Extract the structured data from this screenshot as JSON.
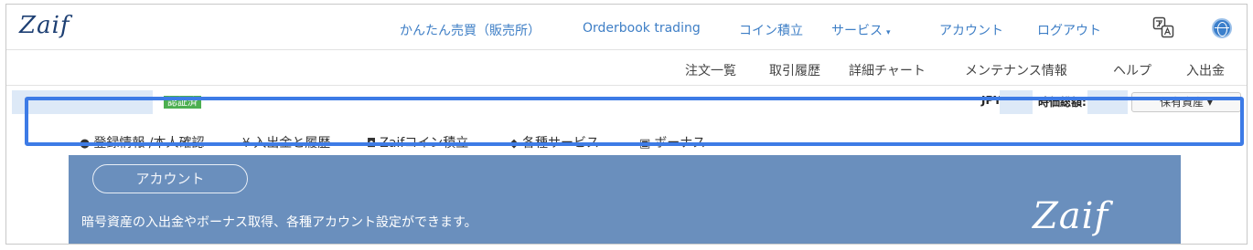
{
  "brand": {
    "logo_text": "Zaif"
  },
  "topnav": {
    "items": [
      {
        "label": "かんたん売買（販売所）"
      },
      {
        "label": "Orderbook trading"
      },
      {
        "label": "コイン積立"
      },
      {
        "label": "サービス",
        "dropdown": true
      },
      {
        "label": "アカウント"
      },
      {
        "label": "ログアウト"
      }
    ],
    "service_chevron": "▾",
    "icons": [
      "translate-icon",
      "globe-icon"
    ]
  },
  "subnav": {
    "items": [
      {
        "label": "注文一覧"
      },
      {
        "label": "取引履歴"
      },
      {
        "label": "詳細チャート"
      },
      {
        "label": "メンテナンス情報"
      },
      {
        "label": "ヘルプ"
      },
      {
        "label": "入出金"
      }
    ]
  },
  "account": {
    "verified_badge": "認証済",
    "jpy_label": "JPY:",
    "total_label": "時価総額:",
    "holdings_button": "保有資産 ▾"
  },
  "account_tabs": [
    {
      "label": "登録情報 /本人確認",
      "icon": "person-icon"
    },
    {
      "label": "入出金と履歴",
      "icon": "yen-icon"
    },
    {
      "label": "Zaifコイン積立",
      "icon": "piggy-bank-icon"
    },
    {
      "label": "各種サービス",
      "icon": "tag-icon"
    },
    {
      "label": "ボーナス",
      "icon": "gift-icon"
    }
  ],
  "hero": {
    "pill_label": "アカウント",
    "description": "暗号資産の入出金やボーナス取得、各種アカウント設定ができます。",
    "logo_text": "Zaif"
  },
  "colors": {
    "brand_navy": "#1d3f73",
    "nav_link": "#3f7fc6",
    "highlight": "#3d7be6",
    "hero_bg": "#6a8fbd",
    "verified_green": "#4caf50"
  }
}
